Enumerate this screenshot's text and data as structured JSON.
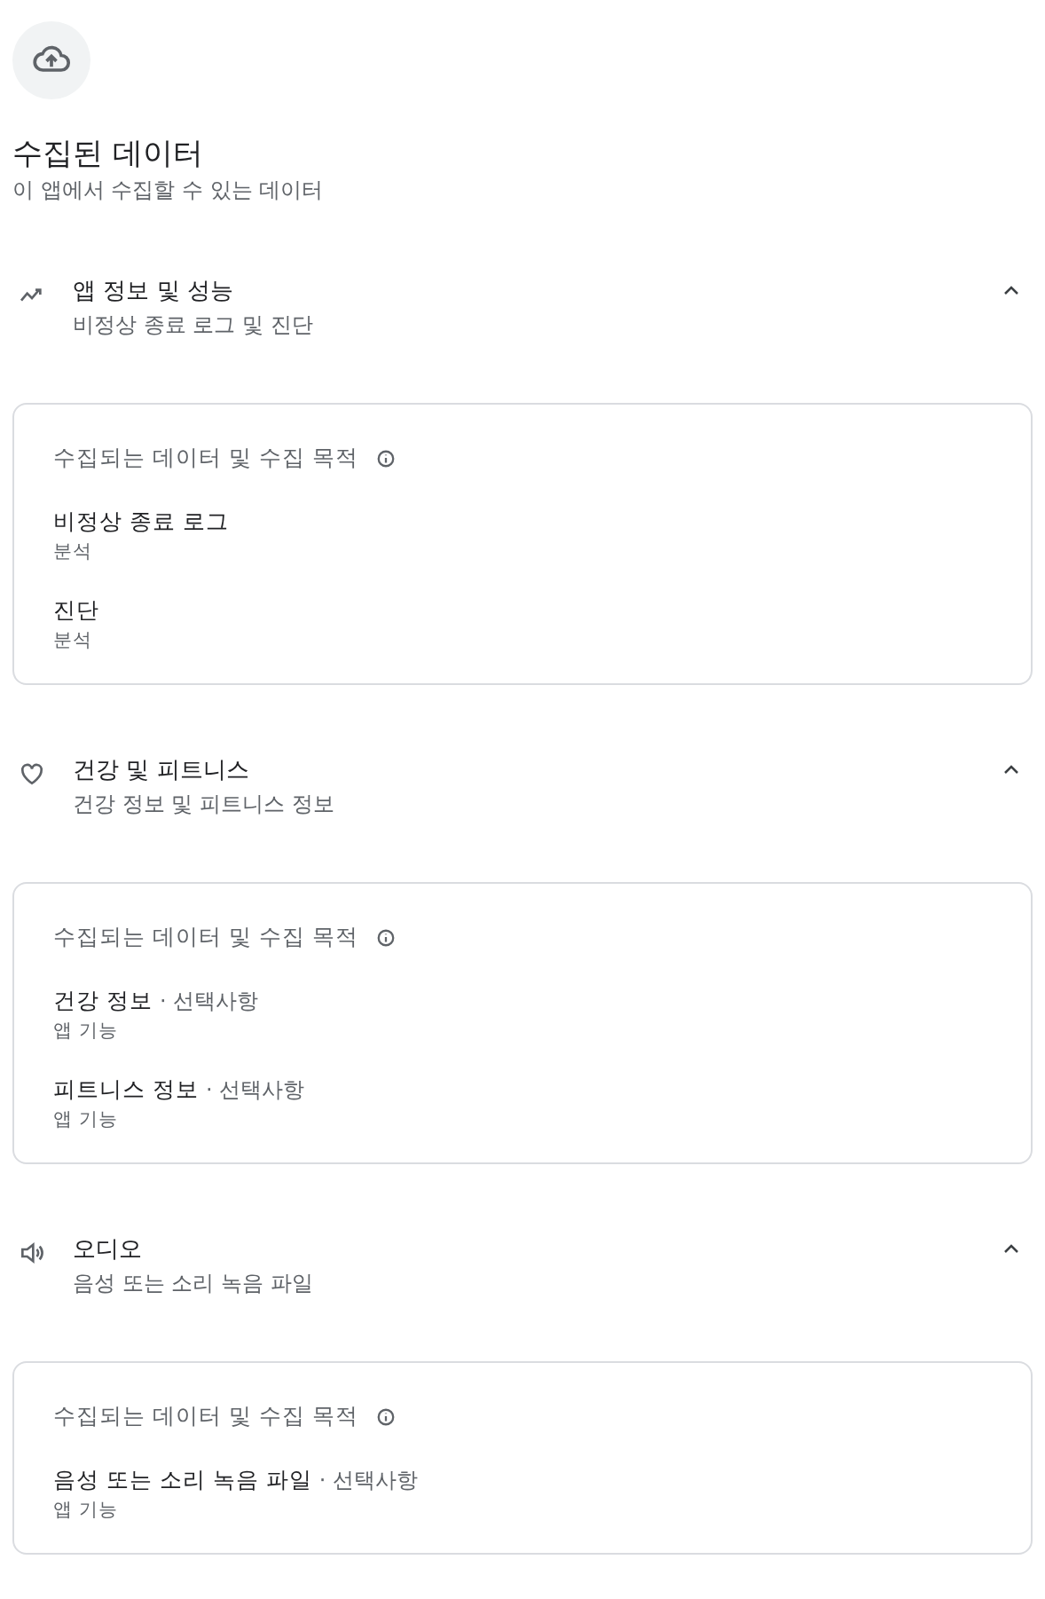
{
  "title": "수집된 데이터",
  "subtitle": "이 앱에서 수집할 수 있는 데이터",
  "sections": [
    {
      "kind": "trend",
      "title": "앱 정보 및 성능",
      "summary": "비정상 종료 로그 및 진단",
      "expanded": true,
      "card_heading": "수집되는 데이터 및 수집 목적",
      "items": [
        {
          "name": "비정상 종료 로그",
          "purpose": "분석"
        },
        {
          "name": "진단",
          "purpose": "분석"
        }
      ]
    },
    {
      "kind": "heart",
      "title": "건강 및 피트니스",
      "summary": "건강 정보 및 피트니스 정보",
      "expanded": true,
      "card_heading": "수집되는 데이터 및 수집 목적",
      "items": [
        {
          "name": "건강 정보",
          "tag": "· 선택사항",
          "purpose": "앱 기능"
        },
        {
          "name": "피트니스 정보",
          "tag": "· 선택사항",
          "purpose": "앱 기능"
        }
      ]
    },
    {
      "kind": "audio",
      "title": "오디오",
      "summary": "음성 또는 소리 녹음 파일",
      "expanded": true,
      "card_heading": "수집되는 데이터 및 수집 목적",
      "items": [
        {
          "name": "음성 또는 소리 녹음 파일",
          "tag": "· 선택사항",
          "purpose": "앱 기능"
        }
      ]
    }
  ]
}
